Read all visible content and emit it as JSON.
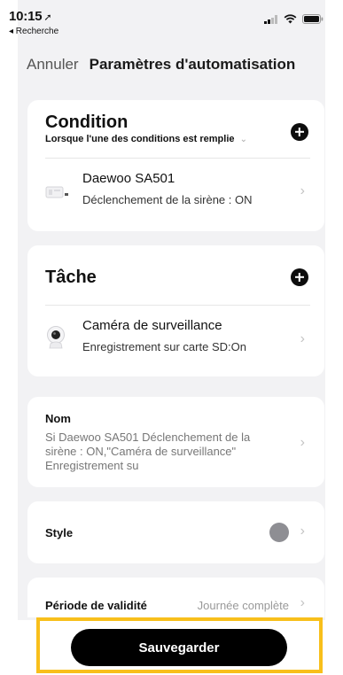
{
  "status_bar": {
    "time": "10:15",
    "back_label": "◂ Recherche"
  },
  "nav": {
    "cancel": "Annuler",
    "title": "Paramètres d'automatisation"
  },
  "condition": {
    "title": "Condition",
    "subtitle": "Lorsque l'une des conditions est remplie",
    "item": {
      "name": "Daewoo SA501",
      "detail": "Déclenchement de la sirène : ON"
    }
  },
  "task": {
    "title": "Tâche",
    "item": {
      "name": "Caméra de surveillance",
      "detail": "Enregistrement sur carte SD:On"
    }
  },
  "name_section": {
    "label": "Nom",
    "value_line1": "Si Daewoo SA501 Déclenchement de la",
    "value_line2": "sirène : ON,\"Caméra de surveillance\"",
    "value_line3": "Enregistrement su"
  },
  "style_section": {
    "label": "Style",
    "color": "#8e8e93"
  },
  "validity": {
    "label": "Période de validité",
    "value": "Journée complète"
  },
  "save_button": "Sauvegarder",
  "colors": {
    "highlight": "#f8bf1b",
    "panel_bg": "#f2f2f4",
    "button_bg": "#000000"
  }
}
